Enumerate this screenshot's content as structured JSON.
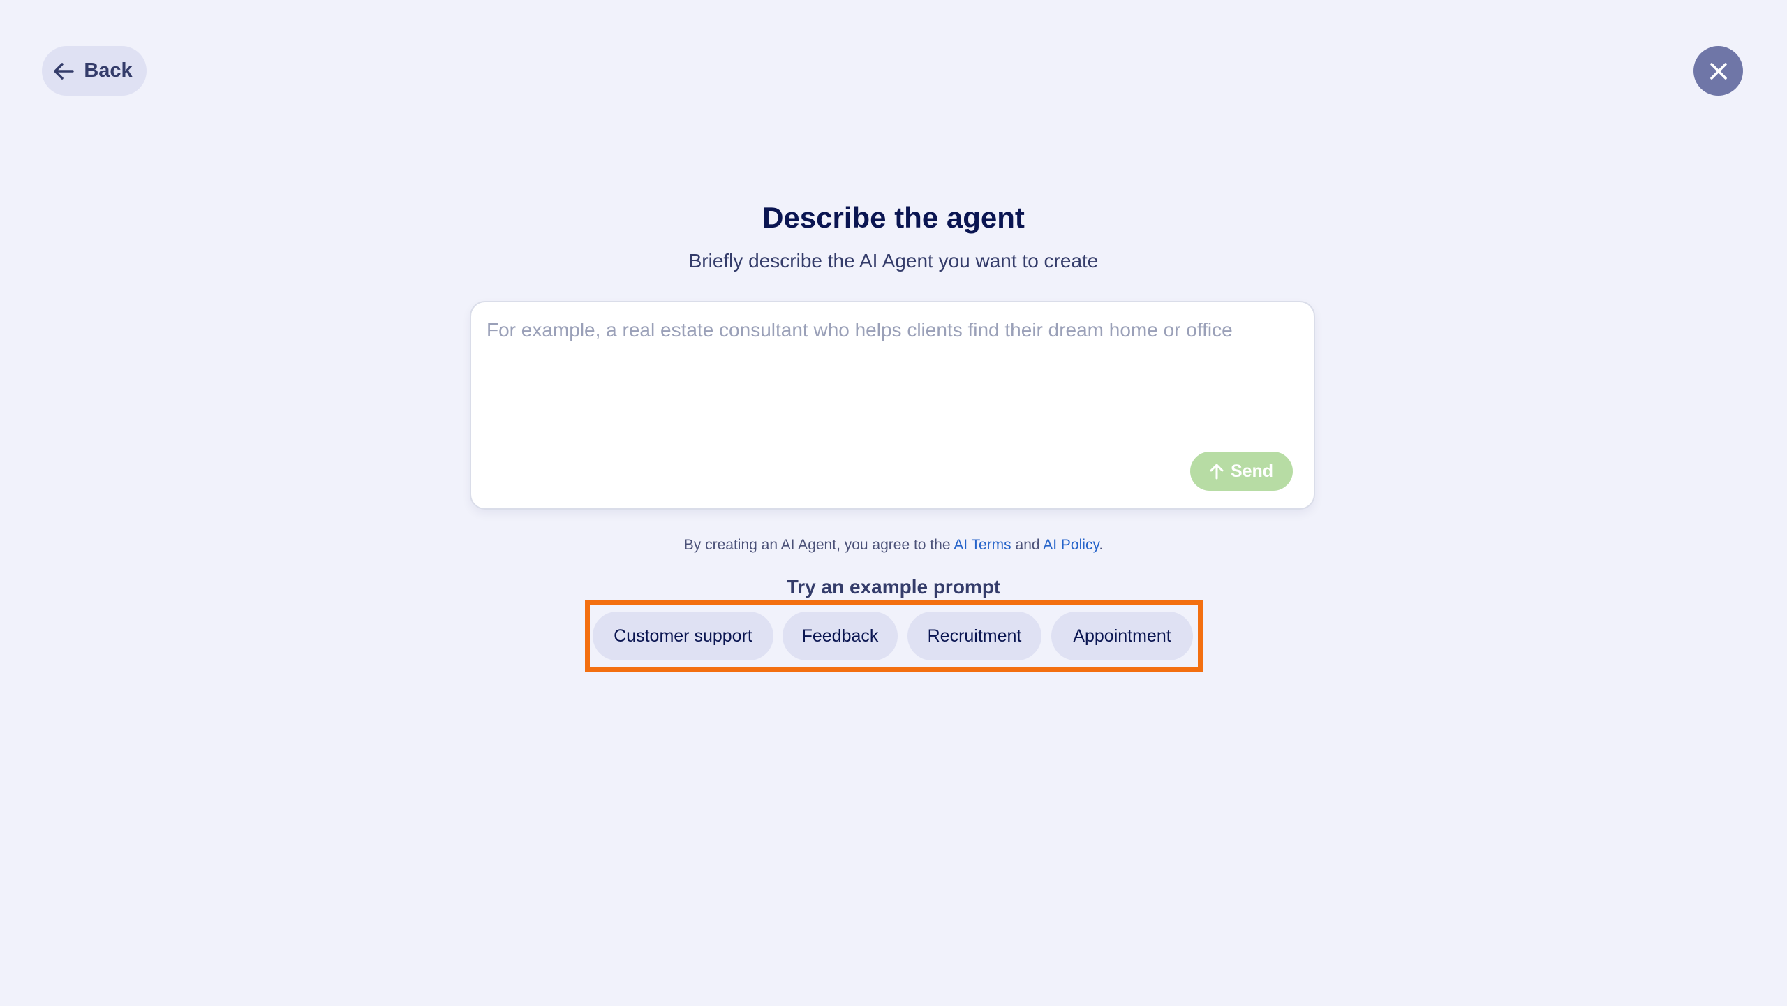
{
  "header": {
    "back_label": "Back",
    "close_icon": "close-icon",
    "back_icon": "arrow-left-icon"
  },
  "main": {
    "title": "Describe the agent",
    "subtitle": "Briefly describe the AI Agent you want to create",
    "prompt": {
      "value": "",
      "placeholder": "For example, a real estate consultant who helps clients find their dream home or office",
      "send_label": "Send",
      "send_icon": "arrow-up-icon"
    },
    "terms": {
      "prefix": "By creating an AI Agent, you agree to the",
      "terms_link": "AI Terms",
      "and": "and",
      "policy_link": "AI Policy",
      "suffix": "."
    },
    "examples": {
      "title": "Try an example prompt",
      "chips": [
        "Customer support",
        "Feedback",
        "Recruitment",
        "Appointment"
      ]
    }
  },
  "colors": {
    "background": "#f1f2fb",
    "primary_text": "#0a1551",
    "send_button": "#b7dca4",
    "close_button": "#6f76a7",
    "chip_background": "#dfe1f3",
    "link": "#2563c9",
    "highlight_frame": "#f36f10"
  }
}
